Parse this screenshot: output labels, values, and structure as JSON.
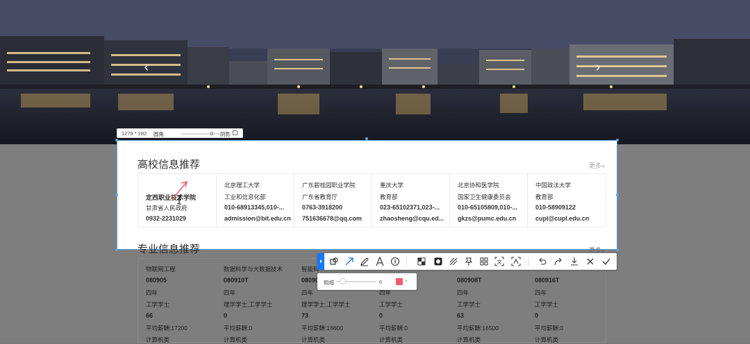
{
  "universities": {
    "title": "高校信息推荐",
    "more": "更多»",
    "items": [
      {
        "name": "定西职业技术学院",
        "dept": "甘肃省人民政府",
        "phone": "0932-2231029",
        "email": ""
      },
      {
        "name": "北京理工大学",
        "dept": "工业和信息化部",
        "phone": "010-68913345,010-...",
        "email": "admission@bit.edu.cn"
      },
      {
        "name": "广东碧桂园职业学院",
        "dept": "广东省教育厅",
        "phone": "0763-3918200",
        "email": "751636678@qq.com"
      },
      {
        "name": "重庆大学",
        "dept": "教育部",
        "phone": "023-65102371,023-...",
        "email": "zhaosheng@cqu.ed..."
      },
      {
        "name": "北京协和医学院",
        "dept": "国家卫生健康委员会",
        "phone": "010-65105809,010-...",
        "email": "gkzs@pumc.edu.cn"
      },
      {
        "name": "中国政法大学",
        "dept": "教育部",
        "phone": "010-58909122",
        "email": "cupl@cupl.edu.cn"
      }
    ]
  },
  "majors": {
    "title": "专业信息推荐",
    "more": "更多»",
    "items": [
      {
        "name": "物联网工程",
        "code": "080905",
        "years": "四年",
        "degree": "工学学士",
        "count": "66",
        "salary": "平均薪酬:17200",
        "cat": "计算机类"
      },
      {
        "name": "数据科学与大数据技术",
        "code": "080910T",
        "years": "四年",
        "degree": "理学学士,工学学士",
        "count": "0",
        "salary": "平均薪酬:0",
        "cat": "计算机类"
      },
      {
        "name": "智能科",
        "code": "08090",
        "years": "四年",
        "degree": "理学学士,工学学士",
        "count": "73",
        "salary": "平均薪酬:16600",
        "cat": "计算机类"
      },
      {
        "name": "",
        "code": "",
        "years": "四年",
        "degree": "工学学士",
        "count": "0",
        "salary": "平均薪酬:0",
        "cat": "计算机类"
      },
      {
        "name": "",
        "code": "080908T",
        "years": "四年",
        "degree": "工学学士",
        "count": "63",
        "salary": "平均薪酬:16500",
        "cat": "计算机类"
      },
      {
        "name": "",
        "code": "080916T",
        "years": "四年",
        "degree": "工学学士",
        "count": "0",
        "salary": "平均薪酬:0",
        "cat": "计算机类"
      }
    ]
  },
  "sizebar": {
    "dims": "1279 * 282",
    "radius_label": "圆角",
    "radius_value": "0",
    "shadow_label": "阴影"
  },
  "subbar": {
    "label": "粗细",
    "value": "6",
    "color": "#ef5b6d"
  },
  "toolbar": {
    "icons": [
      "select-icon",
      "shape-icon",
      "arrow-icon",
      "pen-icon",
      "text-icon",
      "number-icon",
      "mosaic-icon",
      "blur-icon",
      "highlight-icon",
      "pin-icon",
      "ocr-icon",
      "translate-icon",
      "scan-icon",
      "undo-icon",
      "redo-icon",
      "download-icon",
      "close-icon",
      "confirm-icon"
    ]
  },
  "colors": {
    "accent": "#1677ff",
    "selection": "#5aa9e6",
    "annotation": "#ef5b6d"
  }
}
